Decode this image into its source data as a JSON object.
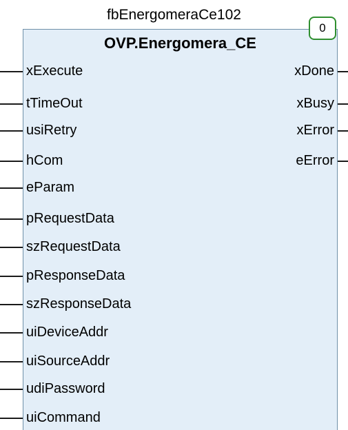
{
  "instance_name": "fbEnergomeraCe102",
  "execution_order": "0",
  "type_name": "OVP.Energomera_CE",
  "inputs": [
    {
      "label": "xExecute"
    },
    {
      "label": "tTimeOut"
    },
    {
      "label": "usiRetry"
    },
    {
      "label": "hCom"
    },
    {
      "label": "eParam"
    },
    {
      "label": "pRequestData"
    },
    {
      "label": "szRequestData"
    },
    {
      "label": "pResponseData"
    },
    {
      "label": "szResponseData"
    },
    {
      "label": "uiDeviceAddr"
    },
    {
      "label": "uiSourceAddr"
    },
    {
      "label": "udiPassword"
    },
    {
      "label": "uiCommand"
    }
  ],
  "outputs": [
    {
      "label": "xDone"
    },
    {
      "label": "xBusy"
    },
    {
      "label": "xError"
    },
    {
      "label": "eError"
    }
  ],
  "colors": {
    "block_fill": "#e3eef8",
    "block_border": "#6f8fa8",
    "badge_border": "#2f8f2f"
  }
}
